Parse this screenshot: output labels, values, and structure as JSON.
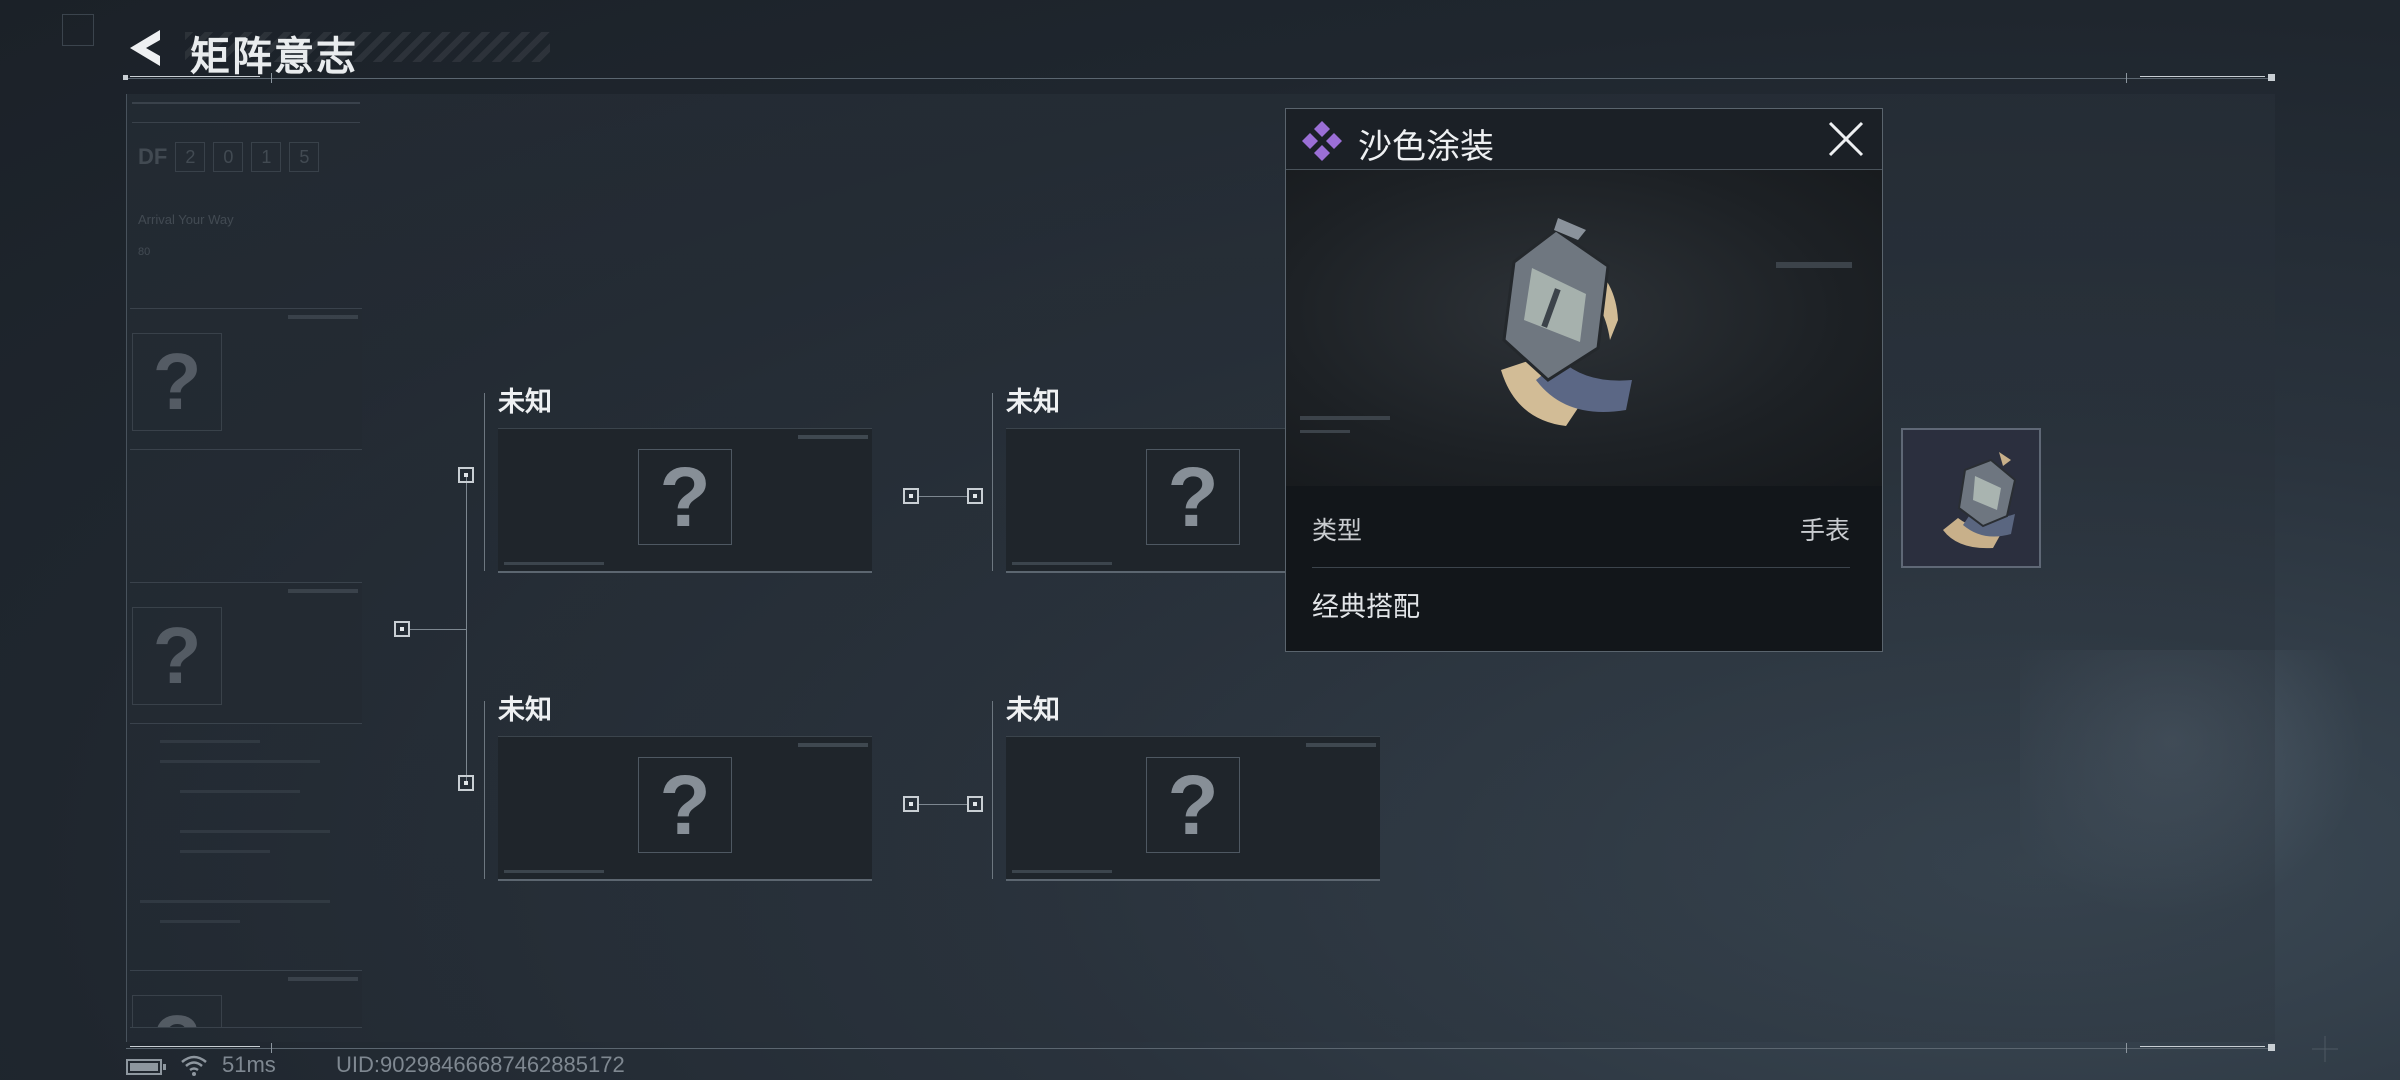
{
  "header": {
    "title": "矩阵意志"
  },
  "left_panel": {
    "df_label": "DF",
    "df_digits": [
      "2",
      "0",
      "1",
      "5"
    ],
    "caption": "Arrival Your Way",
    "caption_sub": "80",
    "cards": [
      {
        "symbol": "?"
      },
      {
        "symbol": "?"
      },
      {
        "symbol": "?"
      }
    ]
  },
  "tree": {
    "nodes": [
      {
        "label": "未知",
        "symbol": "?"
      },
      {
        "label": "未知",
        "symbol": "?"
      },
      {
        "label": "未知",
        "symbol": "?"
      },
      {
        "label": "未知",
        "symbol": "?"
      }
    ]
  },
  "popup": {
    "title": "沙色涂装",
    "type_label": "类型",
    "type_value": "手表",
    "description": "经典搭配",
    "rarity_color": "#9b6fd6"
  },
  "status_bar": {
    "ping": "51ms",
    "uid": "UID:9029846668746288517​2"
  },
  "colors": {
    "accent": "#9b6fd6",
    "background": "#1f262e",
    "text": "#eef0f2"
  }
}
